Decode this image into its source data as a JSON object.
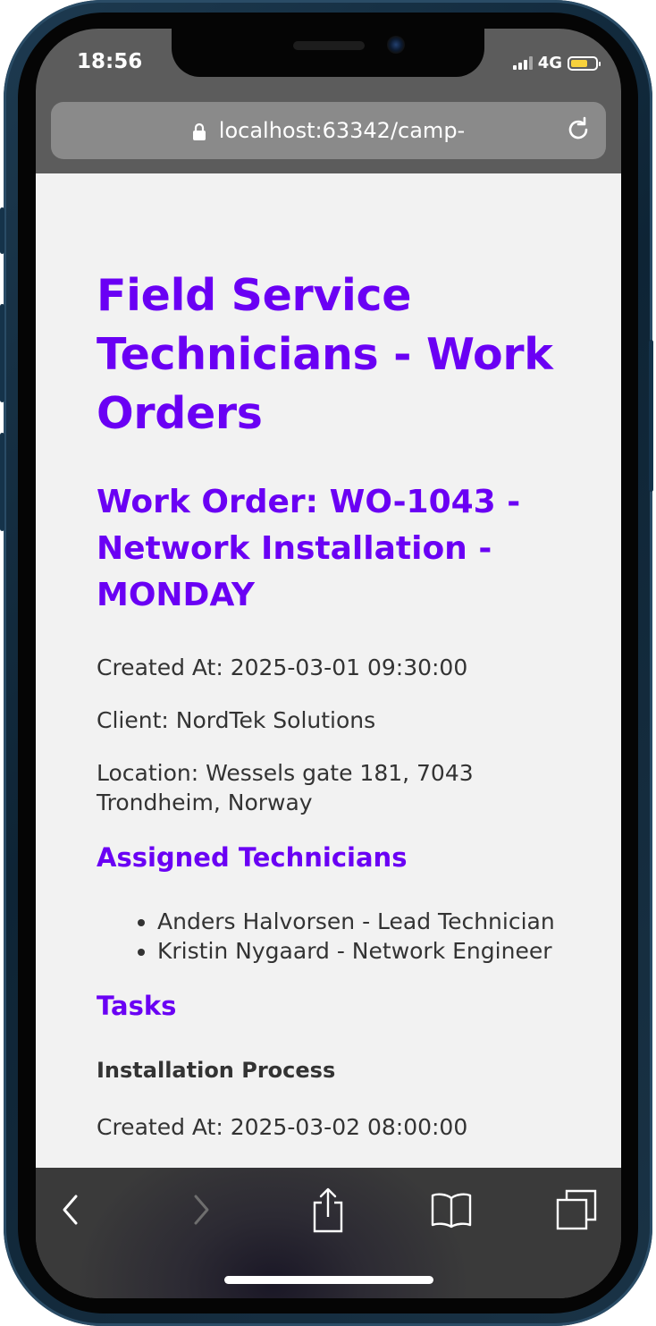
{
  "status_bar": {
    "time": "18:56",
    "network": "4G",
    "battery_level_pct": 70,
    "battery_color": "#f7d13c"
  },
  "browser": {
    "url": "localhost:63342/camp-",
    "lock_icon": "lock-icon",
    "reload_icon": "reload-icon"
  },
  "page": {
    "title": "Field Service Technicians - Work Orders",
    "work_order_heading": "Work Order: WO-1043 - Network Installation - MONDAY",
    "created_at": "Created At: 2025-03-01 09:30:00",
    "client": "Client: NordTek Solutions",
    "location": "Location: Wessels gate 181, 7043 Trondheim, Norway",
    "technicians_heading": "Assigned Technicians",
    "technicians": [
      "Anders Halvorsen - Lead Technician",
      "Kristin Nygaard - Network Engineer"
    ],
    "tasks_heading": "Tasks",
    "task_title": "Installation Process",
    "task_created_at": "Created At: 2025-03-02 08:00:00",
    "accent_color": "#6a00f4"
  },
  "toolbar": {
    "buttons": [
      "back-icon",
      "forward-icon",
      "share-icon",
      "bookmarks-icon",
      "tabs-icon"
    ]
  }
}
